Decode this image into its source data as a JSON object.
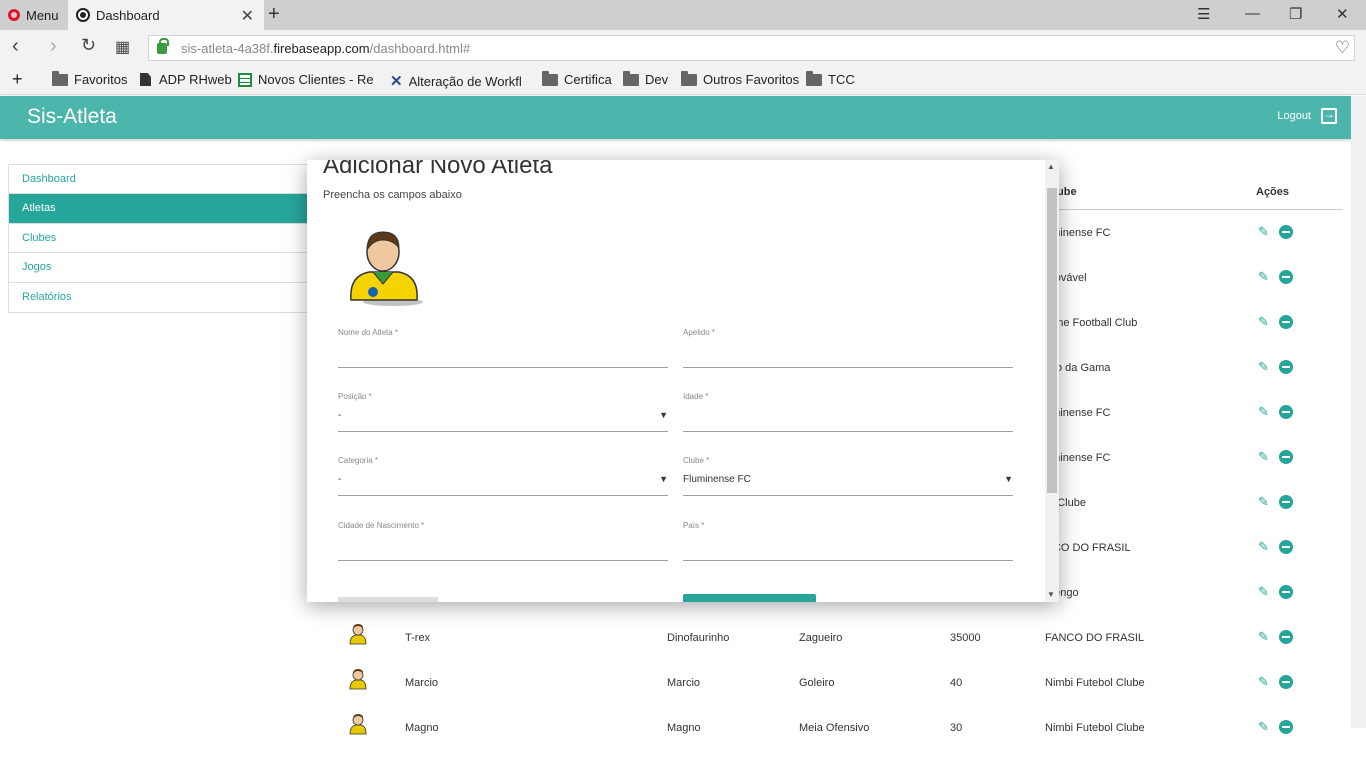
{
  "browser": {
    "menu_label": "Menu",
    "tab_title": "Dashboard",
    "url_prefix": "sis-atleta-4a38f.",
    "url_domain": "firebaseapp.com",
    "url_path": "/dashboard.html#",
    "bookmarks": [
      "Favoritos",
      "ADP RHweb",
      "Novos Clientes - Redc",
      "Alteração de Workflo",
      "Certifica",
      "Dev",
      "Outros Favoritos",
      "TCC"
    ]
  },
  "app": {
    "brand": "Sis-Atleta",
    "logout": "Logout",
    "accent": "#4db6ac",
    "accent_dark": "#26a69a"
  },
  "sidebar": {
    "items": [
      {
        "label": "Dashboard",
        "active": false
      },
      {
        "label": "Atletas",
        "active": true
      },
      {
        "label": "Clubes",
        "active": false
      },
      {
        "label": "Jogos",
        "active": false
      },
      {
        "label": "Relatórios",
        "active": false
      }
    ]
  },
  "table": {
    "headers": {
      "clube": "ube",
      "acoes": "Ações"
    },
    "rows": [
      {
        "nome": "",
        "apelido": "",
        "posicao": "",
        "idade": "",
        "clube": "uminense FC"
      },
      {
        "nome": "",
        "apelido": "",
        "posicao": "",
        "idade": "",
        "clube": "provável"
      },
      {
        "nome": "",
        "apelido": "",
        "posicao": "",
        "idade": "",
        "clube": "none Football Club"
      },
      {
        "nome": "",
        "apelido": "",
        "posicao": "",
        "idade": "",
        "clube": "sco da Gama"
      },
      {
        "nome": "",
        "apelido": "",
        "posicao": "",
        "idade": "",
        "clube": "uminense FC"
      },
      {
        "nome": "",
        "apelido": "",
        "posicao": "",
        "idade": "",
        "clube": "uminense FC"
      },
      {
        "nome": "",
        "apelido": "",
        "posicao": "",
        "idade": "",
        "clube": "m Clube"
      },
      {
        "nome": "",
        "apelido": "",
        "posicao": "",
        "idade": "",
        "clube": "NCO DO FRASIL"
      },
      {
        "nome": "",
        "apelido": "",
        "posicao": "",
        "idade": "",
        "clube": "mengo"
      },
      {
        "nome": "T-rex",
        "apelido": "Dinofaurinho",
        "posicao": "Zagueiro",
        "idade": "35000",
        "clube": "FANCO DO FRASIL"
      },
      {
        "nome": "Marcio",
        "apelido": "Marcio",
        "posicao": "Goleiro",
        "idade": "40",
        "clube": "Nimbi Futebol Clube"
      },
      {
        "nome": "Magno",
        "apelido": "Magno",
        "posicao": "Meia Ofensivo",
        "idade": "30",
        "clube": "Nimbi Futebol Clube"
      }
    ]
  },
  "modal": {
    "title": "Adicionar Novo Atleta",
    "subtitle": "Preencha os campos abaixo",
    "fields": {
      "nome": {
        "label": "Nome do Atleta *",
        "value": ""
      },
      "apelido": {
        "label": "Apelido *",
        "value": ""
      },
      "posicao": {
        "label": "Posição *",
        "value": "-"
      },
      "idade": {
        "label": "Idade *",
        "value": ""
      },
      "categoria": {
        "label": "Categoria *",
        "value": "-"
      },
      "clube": {
        "label": "Clube *",
        "value": "Fluminense FC"
      },
      "cidade": {
        "label": "Cidade de Nascimento *",
        "value": ""
      },
      "pais": {
        "label": "País *",
        "value": ""
      }
    }
  }
}
